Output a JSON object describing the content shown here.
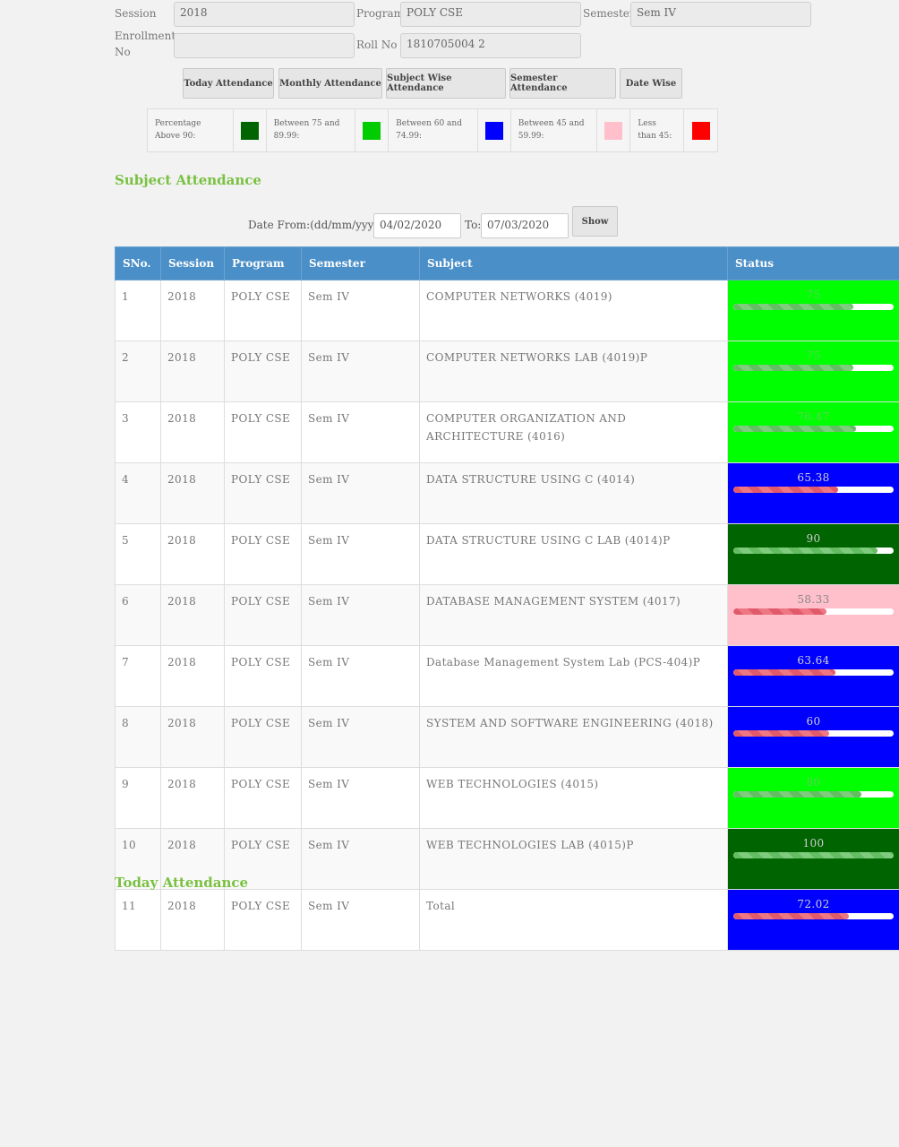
{
  "form": {
    "session_label": "Session",
    "session_value": "2018",
    "program_label": "Program",
    "program_value": "POLY CSE",
    "semester_label": "Semester",
    "semester_value": "Sem IV",
    "enrollment_label": "Enrollment No",
    "enrollment_value": "",
    "roll_label": "Roll No",
    "roll_value": "1810705004 2"
  },
  "tabs": [
    "Today Attendance",
    "Monthly Attendance",
    "Subject Wise Attendance",
    "Semester Attendance",
    "Date Wise"
  ],
  "legend": [
    {
      "label": "Percentage Above 90:",
      "color": "#006400"
    },
    {
      "label": "Between 75 and 89.99:",
      "color": "#00cc00"
    },
    {
      "label": "Between 60 and 74.99:",
      "color": "#0000ff"
    },
    {
      "label": "Between 45 and 59.99:",
      "color": "#ffc0cb"
    },
    {
      "label": "Less than 45:",
      "color": "#ff0000"
    }
  ],
  "subject_section_title": "Subject Attendance",
  "date_filter": {
    "from_label": "Date From:(dd/mm/yyyy)",
    "from_value": "04/02/2020",
    "to_label": "To:",
    "to_value": "07/03/2020",
    "show_label": "Show"
  },
  "table": {
    "headers": [
      "SNo.",
      "Session",
      "Program",
      "Semester",
      "Subject",
      "Status"
    ],
    "rows": [
      {
        "sno": "1",
        "session": "2018",
        "program": "POLY CSE",
        "semester": "Sem IV",
        "subject": "COMPUTER NETWORKS (4019)",
        "status": "75",
        "percent": 75,
        "bg": "#00ff00",
        "fill": "good"
      },
      {
        "sno": "2",
        "session": "2018",
        "program": "POLY CSE",
        "semester": "Sem IV",
        "subject": "COMPUTER NETWORKS LAB (4019)P",
        "status": "75",
        "percent": 75,
        "bg": "#00ff00",
        "fill": "good"
      },
      {
        "sno": "3",
        "session": "2018",
        "program": "POLY CSE",
        "semester": "Sem IV",
        "subject": "COMPUTER ORGANIZATION AND ARCHITECTURE (4016)",
        "status": "76.47",
        "percent": 76.47,
        "bg": "#00ff00",
        "fill": "good"
      },
      {
        "sno": "4",
        "session": "2018",
        "program": "POLY CSE",
        "semester": "Sem IV",
        "subject": "DATA STRUCTURE USING C (4014)",
        "status": "65.38",
        "percent": 65.38,
        "bg": "#0000ff",
        "fill": "bad"
      },
      {
        "sno": "5",
        "session": "2018",
        "program": "POLY CSE",
        "semester": "Sem IV",
        "subject": "DATA STRUCTURE USING C LAB (4014)P",
        "status": "90",
        "percent": 90,
        "bg": "#006400",
        "fill": "good"
      },
      {
        "sno": "6",
        "session": "2018",
        "program": "POLY CSE",
        "semester": "Sem IV",
        "subject": "DATABASE MANAGEMENT SYSTEM (4017)",
        "status": "58.33",
        "percent": 58.33,
        "bg": "#ffc0cb",
        "fill": "bad"
      },
      {
        "sno": "7",
        "session": "2018",
        "program": "POLY CSE",
        "semester": "Sem IV",
        "subject": "Database Management System Lab (PCS-404)P",
        "status": "63.64",
        "percent": 63.64,
        "bg": "#0000ff",
        "fill": "bad"
      },
      {
        "sno": "8",
        "session": "2018",
        "program": "POLY CSE",
        "semester": "Sem IV",
        "subject": "SYSTEM AND SOFTWARE ENGINEERING (4018)",
        "status": "60",
        "percent": 60,
        "bg": "#0000ff",
        "fill": "bad"
      },
      {
        "sno": "9",
        "session": "2018",
        "program": "POLY CSE",
        "semester": "Sem IV",
        "subject": "WEB TECHNOLOGIES (4015)",
        "status": "80",
        "percent": 80,
        "bg": "#00ff00",
        "fill": "good"
      },
      {
        "sno": "10",
        "session": "2018",
        "program": "POLY CSE",
        "semester": "Sem IV",
        "subject": "WEB TECHNOLOGIES LAB (4015)P",
        "status": "100",
        "percent": 100,
        "bg": "#006400",
        "fill": "good"
      },
      {
        "sno": "11",
        "session": "2018",
        "program": "POLY CSE",
        "semester": "Sem IV",
        "subject": "Total",
        "status": "72.02",
        "percent": 72.02,
        "bg": "#0000ff",
        "fill": "bad"
      }
    ]
  },
  "today_section_title": "Today Attendance"
}
